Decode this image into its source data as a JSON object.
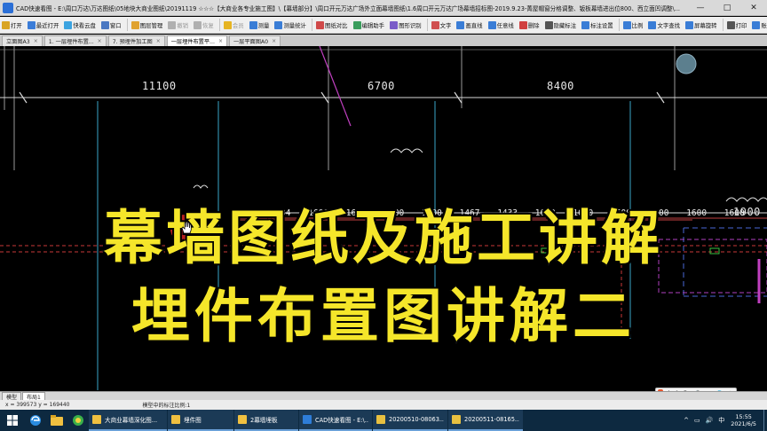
{
  "window": {
    "title": "CAD快速看图 - E:\\周口万达\\万达图纸\\05地块大商业图纸\\20191119 ☆☆☆【大商业各专业施工图】\\【幕墙部分】\\周口开元万达广场外立面幕墙图纸\\1.6周口开元万达广场幕墙招标图-2019.9.23-菁屋帽窗分格调整、钣板幕墙进出位800、西立面凹调整\\...",
    "controls": [
      "—",
      "□",
      "✕"
    ]
  },
  "toolbar": {
    "buttons": [
      {
        "label": "打开",
        "color": "#d9a422",
        "disabled": false
      },
      {
        "label": "最近打开",
        "color": "#3b7dd8",
        "disabled": false
      },
      {
        "label": "快看云盘",
        "color": "#3ba3e0",
        "disabled": false
      },
      {
        "label": "窗口",
        "color": "#4a78c2",
        "disabled": false
      },
      {
        "label": "图层管理",
        "color": "#e0a230",
        "disabled": false
      },
      {
        "label": "撤销",
        "color": "#b0b0b0",
        "disabled": true
      },
      {
        "label": "恢复",
        "color": "#b0b0b0",
        "disabled": true
      },
      {
        "label": "会员",
        "color": "#e6b422",
        "disabled": true
      },
      {
        "label": "测量",
        "color": "#3a7dd6",
        "disabled": false
      },
      {
        "label": "测量统计",
        "color": "#3a7dd6",
        "disabled": false
      },
      {
        "label": "图纸对比",
        "color": "#d04a4a",
        "disabled": false
      },
      {
        "label": "编辑助手",
        "color": "#3a9d5c",
        "disabled": false
      },
      {
        "label": "图形识别",
        "color": "#7a5cc8",
        "disabled": false
      },
      {
        "label": "文字",
        "color": "#d05050",
        "disabled": false
      },
      {
        "label": "画直线",
        "color": "#3a7dd6",
        "disabled": false
      },
      {
        "label": "任意线",
        "color": "#3a7dd6",
        "disabled": false
      },
      {
        "label": "删除",
        "color": "#d04040",
        "disabled": false
      },
      {
        "label": "隐藏标注",
        "color": "#555555",
        "disabled": false
      },
      {
        "label": "标注设置",
        "color": "#3a7dd6",
        "disabled": false
      },
      {
        "label": "比例",
        "color": "#3a7dd6",
        "disabled": false
      },
      {
        "label": "文字查找",
        "color": "#3a7dd6",
        "disabled": false
      },
      {
        "label": "屏幕旋转",
        "color": "#3a7dd6",
        "disabled": false
      },
      {
        "label": "打印",
        "color": "#555555",
        "disabled": false
      },
      {
        "label": "账号",
        "color": "#3a7dd6",
        "disabled": false
      },
      {
        "label": "客服",
        "color": "#3a9d5c",
        "disabled": false
      },
      {
        "label": "风格",
        "color": "#d9a422",
        "disabled": false
      },
      {
        "label": "关于",
        "color": "#3a7dd6",
        "disabled": false
      }
    ]
  },
  "tabs": [
    {
      "label": "立面图A3",
      "active": false
    },
    {
      "label": "1. 一层埋件布置...",
      "active": false
    },
    {
      "label": "7. 预埋件加工图",
      "active": false
    },
    {
      "label": "一层埋件布置平...",
      "active": true
    },
    {
      "label": "一层平面图A0",
      "active": false
    }
  ],
  "drawing": {
    "dimensions_top": [
      {
        "text": "11100"
      },
      {
        "text": "6700"
      },
      {
        "text": "8400"
      }
    ],
    "dimensions_row": [
      "1600",
      "1584",
      "1600",
      "1600",
      "1600",
      "1600",
      "1467",
      "1433",
      "1600",
      "1600",
      "1600",
      "1600",
      "1600",
      "1600"
    ],
    "dimension_right": "1900"
  },
  "overlay": {
    "line1": "幕墙图纸及施工讲解",
    "line2": "埋件布置图讲解二"
  },
  "layouts": [
    {
      "label": "模型",
      "active": false
    },
    {
      "label": "布局1",
      "active": true
    }
  ],
  "status": {
    "coords": "x = 399573  y = 169440",
    "scale": "模型中的标注比例:1"
  },
  "ime": {
    "logo": "S",
    "items": [
      "中",
      "°",
      "☺",
      "🎤",
      "⌨",
      "👕",
      "⚙"
    ]
  },
  "taskbar": {
    "apps": [
      {
        "label": "大商业幕墙深化图...",
        "color": "#f0c040"
      },
      {
        "label": "埋件图",
        "color": "#f0c040"
      },
      {
        "label": "2幕墙埋板",
        "color": "#f0c040"
      },
      {
        "label": "CAD快速看图 - E:\\...",
        "color": "#2e7dd8"
      },
      {
        "label": "20200510-08063...",
        "color": "#e8c040"
      },
      {
        "label": "20200511-08165...",
        "color": "#e8c040"
      }
    ],
    "tray": [
      "^",
      "▭",
      "🔊",
      "中"
    ],
    "time": "15:55",
    "date": "2021/6/5"
  }
}
